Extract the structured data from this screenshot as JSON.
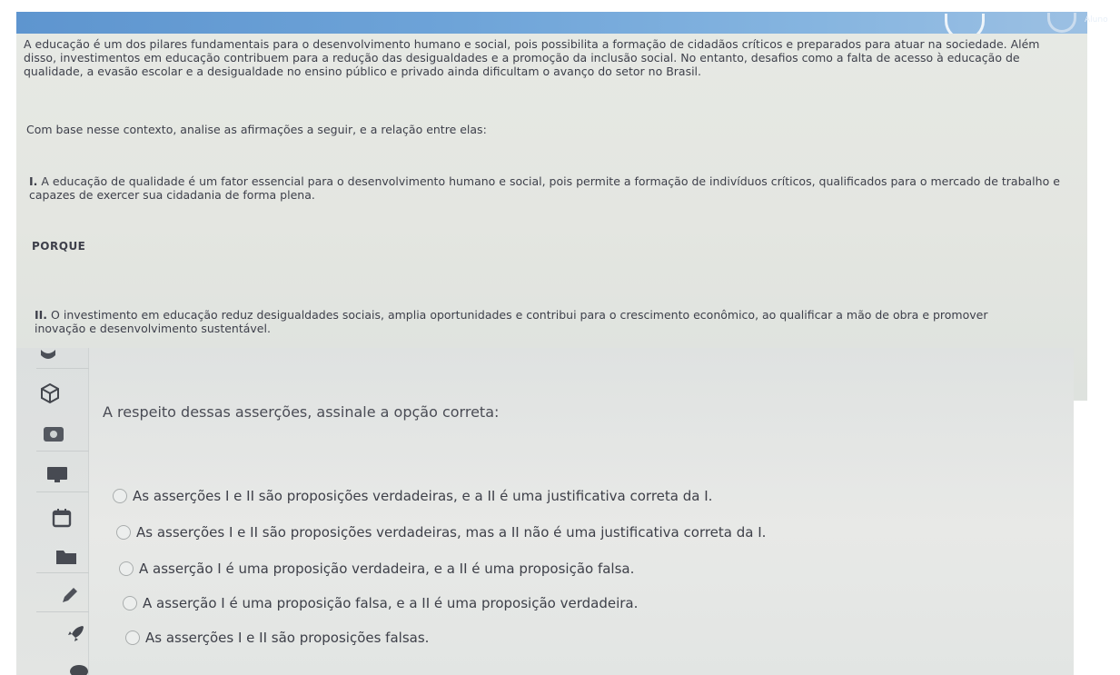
{
  "header": {
    "user_label": "Aluno",
    "accent_color": "#6da3d8"
  },
  "question": {
    "intro": "A educação é um dos pilares fundamentais para o desenvolvimento humano e social, pois possibilita a formação de cidadãos críticos e preparados para atuar na sociedade. Além disso, investimentos em educação contribuem para a redução das desigualdades e a promoção da inclusão social. No entanto, desafios como a falta de acesso à educação de qualidade, a evasão escolar e a desigualdade no ensino público e privado ainda dificultam o avanço do setor no Brasil.",
    "context": "Com base nesse contexto, analise as afirmações a seguir, e a relação entre elas:",
    "assertion_1_num": "I.",
    "assertion_1": "A educação de qualidade é um fator essencial para o desenvolvimento humano e social, pois permite a formação de indivíduos críticos, qualificados para o mercado de trabalho e capazes de exercer sua cidadania de forma plena.",
    "connector": "PORQUE",
    "assertion_2_num": "II.",
    "assertion_2": "O investimento em educação reduz desigualdades sociais, amplia oportunidades e contribui para o crescimento econômico, ao qualificar a mão de obra e promover inovação e desenvolvimento sustentável."
  },
  "answers": {
    "prompt": "A respeito dessas asserções, assinale a opção correta:",
    "options": [
      "As asserções I e II são proposições verdadeiras, e a II é uma justificativa correta da I.",
      "As asserções I e II são proposições verdadeiras, mas a II não é uma justificativa correta da I.",
      "A asserção I é uma proposição verdadeira, e a II é uma proposição falsa.",
      "A asserção I é uma proposição falsa, e a II é uma proposição verdadeira.",
      "As asserções I e II são proposições falsas."
    ]
  },
  "sidebar": {
    "icons": [
      "info-icon",
      "cube-icon",
      "badge-icon",
      "monitor-icon",
      "calendar-icon",
      "folder-icon",
      "pencil-icon",
      "rocket-icon",
      "chat-icon"
    ]
  }
}
